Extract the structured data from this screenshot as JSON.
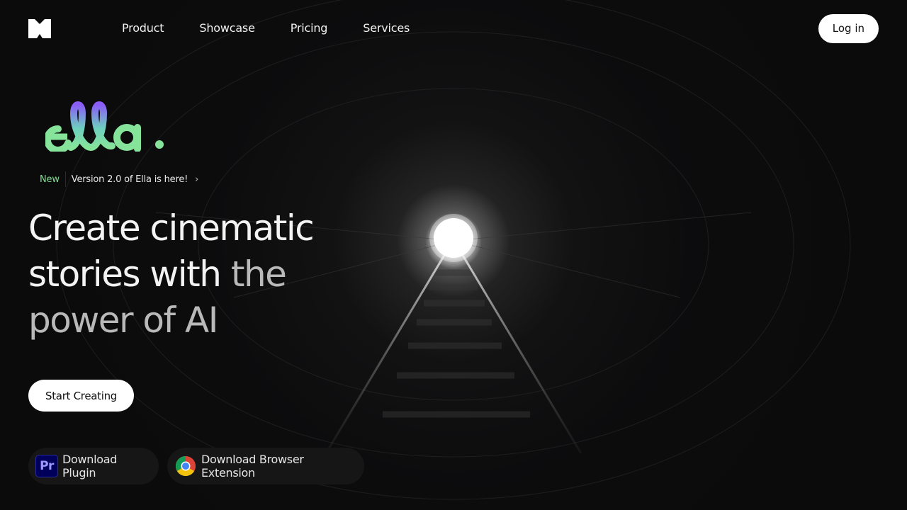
{
  "header": {
    "nav": [
      "Product",
      "Showcase",
      "Pricing",
      "Services"
    ],
    "login_label": "Log in"
  },
  "brand": {
    "wordmark": "ella."
  },
  "announcement": {
    "badge": "New",
    "message": "Version 2.0 of Ella is here!",
    "chevron": "›"
  },
  "hero": {
    "headline_bright_1": "Create cinematic",
    "headline_bright_2": "stories with",
    "headline_dim_1": "the",
    "headline_dim_2": "power of AI",
    "cta_label": "Start Creating"
  },
  "downloads": {
    "plugin_label": "Download Plugin",
    "plugin_icon_text": "Pr",
    "extension_label": "Download Browser Extension"
  },
  "icons": {
    "logo": "brand-logo-icon",
    "chevron": "chevron-right-icon",
    "premiere": "adobe-premiere-icon",
    "chrome": "chrome-icon"
  },
  "colors": {
    "background": "#0b0b0c",
    "accent_green": "#7ee08f",
    "accent_purple": "#8b5cf6",
    "button_bg": "#ffffff"
  }
}
